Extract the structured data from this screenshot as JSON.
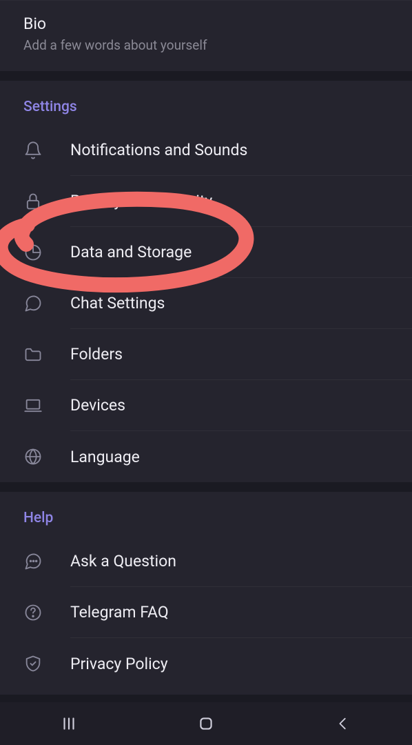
{
  "bio": {
    "title": "Bio",
    "subtitle": "Add a few words about yourself"
  },
  "settings": {
    "header": "Settings",
    "items": [
      {
        "label": "Notifications and Sounds"
      },
      {
        "label": "Privacy and Security"
      },
      {
        "label": "Data and Storage"
      },
      {
        "label": "Chat Settings"
      },
      {
        "label": "Folders"
      },
      {
        "label": "Devices"
      },
      {
        "label": "Language"
      }
    ]
  },
  "help": {
    "header": "Help",
    "items": [
      {
        "label": "Ask a Question"
      },
      {
        "label": "Telegram FAQ"
      },
      {
        "label": "Privacy Policy"
      }
    ]
  },
  "annotation": {
    "target_label": "Data and Storage",
    "color": "#f06a66"
  }
}
